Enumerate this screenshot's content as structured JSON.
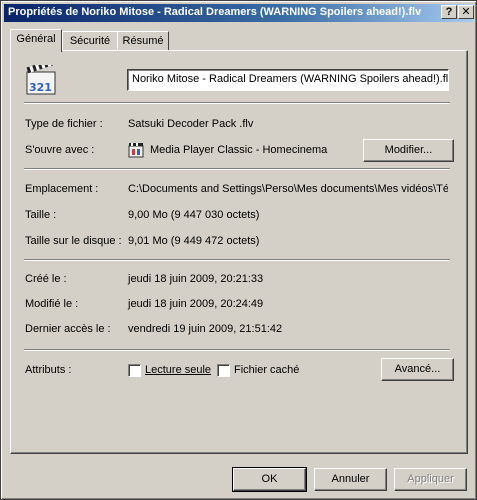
{
  "window": {
    "title": "Propriétés de Noriko Mitose - Radical Dreamers (WARNING  Spoilers ahead!).flv",
    "help_glyph": "?",
    "close_glyph": "✕"
  },
  "tabs": [
    {
      "label": "Général"
    },
    {
      "label": "Sécurité"
    },
    {
      "label": "Résumé"
    }
  ],
  "file": {
    "icon": "media-file-icon",
    "icon_text": "321",
    "name": "Noriko Mitose - Radical Dreamers (WARNING  Spoilers ahead!).flv"
  },
  "type": {
    "label": "Type de fichier :",
    "value": "Satsuki Decoder Pack .flv"
  },
  "opens_with": {
    "label": "S'ouvre avec :",
    "app_icon": "media-player-icon",
    "value": "Media Player Classic - Homecinema",
    "modify_button": "Modifier..."
  },
  "location": {
    "label": "Emplacement :",
    "value": "C:\\Documents and Settings\\Perso\\Mes documents\\Mes vidéos\\Télé"
  },
  "size": {
    "label": "Taille :",
    "value": "9,00 Mo (9 447 030 octets)"
  },
  "size_on_disk": {
    "label": "Taille sur le disque :",
    "value": "9,01 Mo (9 449 472 octets)"
  },
  "created": {
    "label": "Créé le :",
    "value": "jeudi 18 juin 2009, 20:21:33"
  },
  "modified": {
    "label": "Modifié le :",
    "value": "jeudi 18 juin 2009, 20:24:49"
  },
  "accessed": {
    "label": "Dernier accès le :",
    "value": "vendredi 19 juin 2009, 21:51:42"
  },
  "attributes": {
    "label": "Attributs :",
    "readonly_label": "Lecture seule",
    "readonly_checked": false,
    "hidden_label": "Fichier caché",
    "hidden_checked": false,
    "advanced_button": "Avancé..."
  },
  "footer": {
    "ok": "OK",
    "cancel": "Annuler",
    "apply": "Appliquer"
  }
}
